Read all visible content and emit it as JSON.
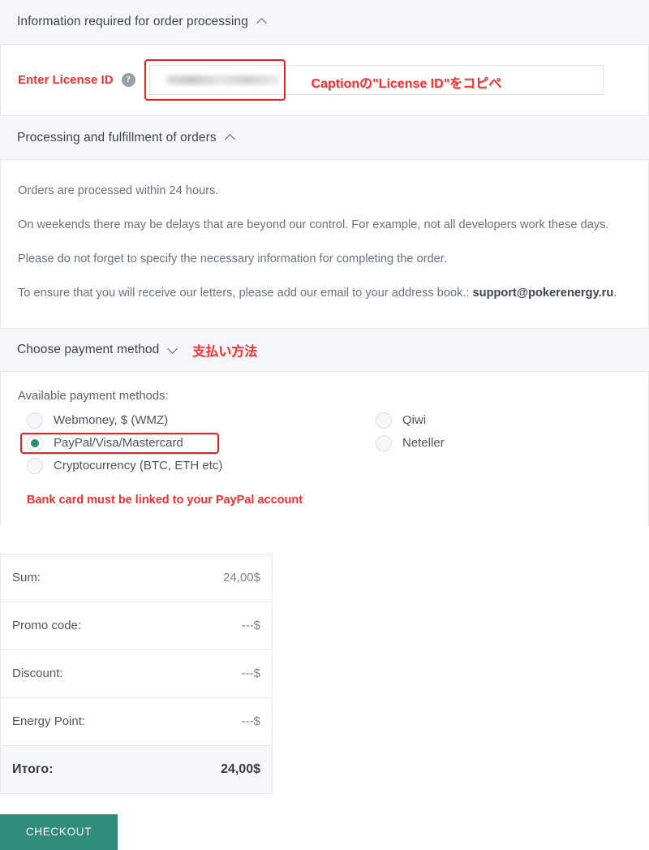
{
  "sections": {
    "order_info": {
      "title": "Information required for order processing",
      "chevron": "chevron-up",
      "license_label": "Enter License ID",
      "help_icon": "help-circle-icon",
      "license_value": "",
      "license_placeholder": "",
      "annotation": "Captionの\"License ID\"をコピペ"
    },
    "processing": {
      "title": "Processing and fulfillment of orders",
      "chevron": "chevron-up",
      "paragraphs": [
        "Orders are processed within 24 hours.",
        "On weekends there may be delays that are beyond our control. For example, not all developers work these days.",
        "Please do not forget to specify the necessary information for completing the order."
      ],
      "email_line_prefix": "To ensure that you will receive our letters, please add our email to your address book.: ",
      "email": "support@pokerenergy.ru",
      "email_line_suffix": "."
    },
    "payment": {
      "title": "Choose payment method",
      "chevron": "chevron-down",
      "annotation": "支払い方法",
      "available_label": "Available payment methods:",
      "methods_left": [
        {
          "label": "Webmoney, $ (WMZ)",
          "selected": false
        },
        {
          "label": "PayPal/Visa/Mastercard",
          "selected": true
        },
        {
          "label": "Cryptocurrency (BTC, ETH etc)",
          "selected": false
        }
      ],
      "methods_right": [
        {
          "label": "Qiwi",
          "selected": false
        },
        {
          "label": "Neteller",
          "selected": false
        }
      ],
      "warning": "Bank card must be linked to your PayPal account"
    }
  },
  "totals": {
    "rows": [
      {
        "label": "Sum:",
        "value": "24,00$"
      },
      {
        "label": "Promo code:",
        "value": "---$"
      },
      {
        "label": "Discount:",
        "value": "---$"
      },
      {
        "label": "Energy Point:",
        "value": "---$"
      }
    ],
    "total": {
      "label": "Итого:",
      "value": "24,00$"
    }
  },
  "checkout": {
    "label": "CHECKOUT"
  },
  "colors": {
    "accent_green": "#2f8c78",
    "annotation_red": "#fb2c2c",
    "selected_radio": "#2b8f73",
    "header_bg": "#f5f6f9"
  }
}
